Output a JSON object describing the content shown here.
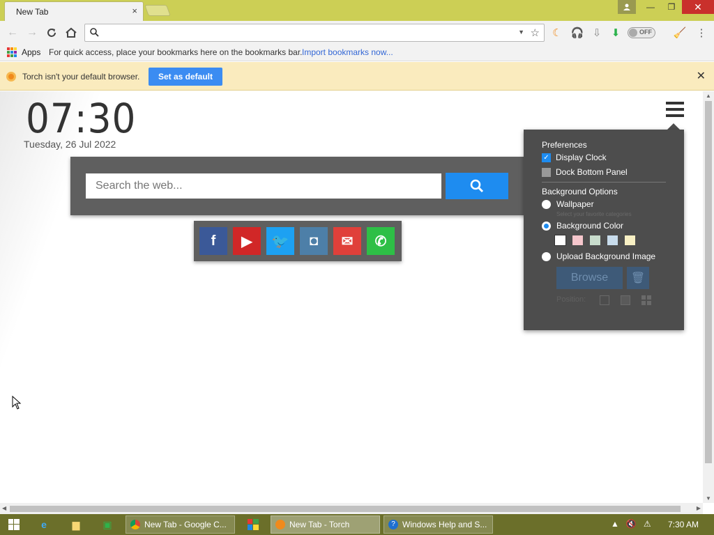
{
  "tabs": {
    "active_title": "New Tab",
    "close_glyph": "×"
  },
  "window_controls": {
    "minimize": "—",
    "restore": "❐",
    "close": "✕"
  },
  "omnibox": {
    "value": "",
    "placeholder": ""
  },
  "extensions": {
    "toggle_label": "OFF"
  },
  "bookmarks": {
    "apps_label": "Apps",
    "hint": "For quick access, place your bookmarks here on the bookmarks bar.",
    "import_link": "Import bookmarks now..."
  },
  "infobar": {
    "message": "Torch isn't your default browser.",
    "button": "Set as default",
    "close": "✕"
  },
  "clock": {
    "time": "07:30",
    "date": "Tuesday,  26 Jul  2022"
  },
  "search": {
    "placeholder": "Search the web..."
  },
  "social": {
    "items": [
      {
        "name": "facebook",
        "glyph": "f",
        "color": "#3b5998"
      },
      {
        "name": "youtube",
        "glyph": "▶",
        "color": "#d12727"
      },
      {
        "name": "twitter",
        "glyph": "🐦",
        "color": "#1da1f2"
      },
      {
        "name": "instagram",
        "glyph": "◘",
        "color": "#4d7fa8"
      },
      {
        "name": "email",
        "glyph": "✉",
        "color": "#e0403a"
      },
      {
        "name": "whatsapp",
        "glyph": "✆",
        "color": "#2ebf46"
      }
    ]
  },
  "preferences": {
    "title": "Preferences",
    "display_clock": "Display Clock",
    "dock_bottom_panel": "Dock Bottom Panel",
    "background_options": "Background Options",
    "wallpaper": "Wallpaper",
    "wallpaper_sub": "Select your favorite categories",
    "background_color": "Background Color",
    "upload_image": "Upload Background Image",
    "browse": "Browse",
    "position": "Position:",
    "swatches": [
      "#ffffff",
      "#f5c6cc",
      "#c8dccc",
      "#c8dcec",
      "#f8f0c4"
    ]
  },
  "taskbar": {
    "tasks": [
      {
        "label": "New Tab - Google C..."
      },
      {
        "label": "New Tab - Torch"
      },
      {
        "label": "Windows Help and S..."
      }
    ],
    "clock": "7:30 AM"
  },
  "colors": {
    "accent": "#1e8cf0",
    "titlebar": "#cccf55",
    "taskbar": "#6b6f2a",
    "infobar": "#faebbe"
  }
}
